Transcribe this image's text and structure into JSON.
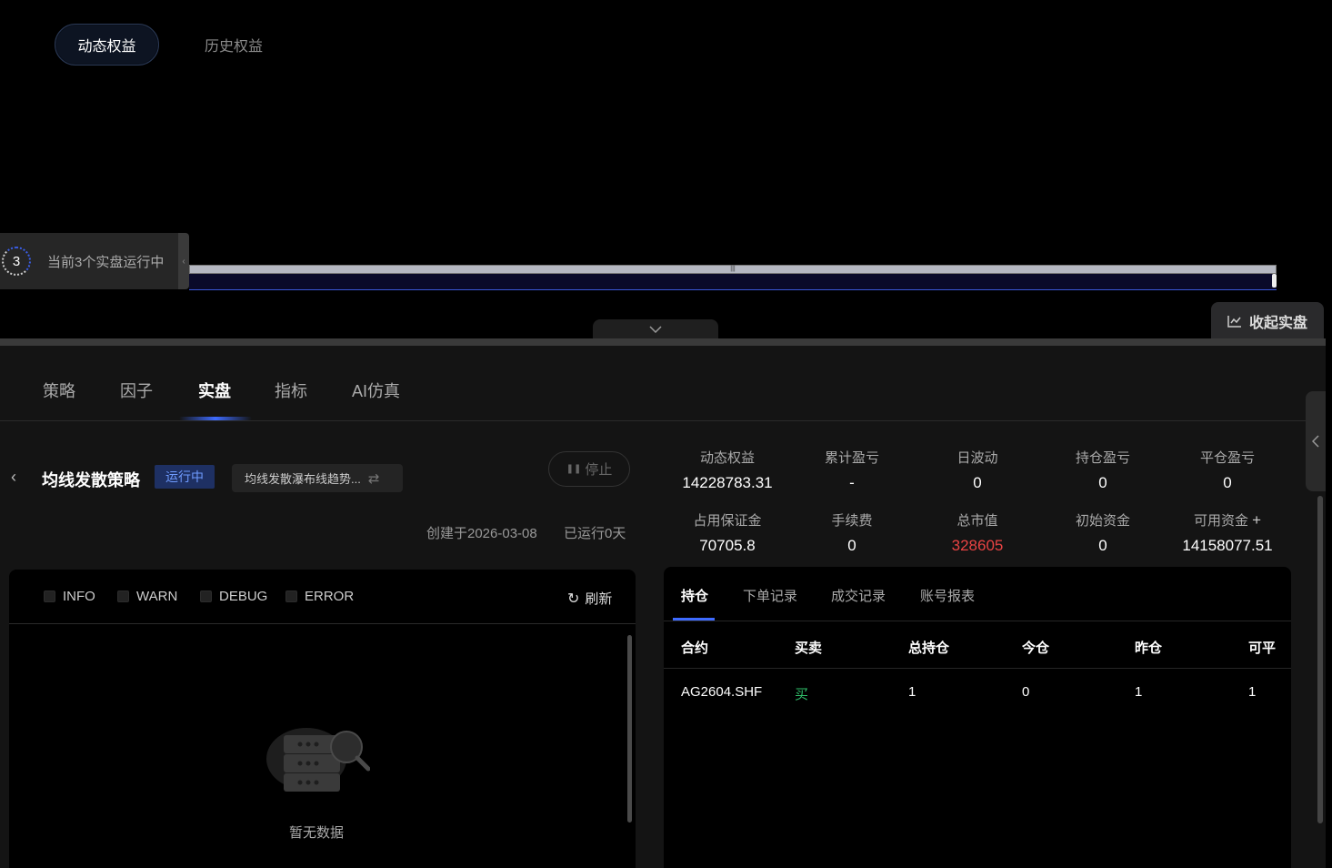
{
  "equity_tabs": {
    "dynamic": "动态权益",
    "history": "历史权益"
  },
  "running": {
    "count": "3",
    "text": "当前3个实盘运行中"
  },
  "collapse_label": "收起实盘",
  "main_tabs": [
    "策略",
    "因子",
    "实盘",
    "指标",
    "AI仿真"
  ],
  "strategy": {
    "name": "均线发散策略",
    "status": "运行中",
    "select_value": "均线发散瀑布线趋势...",
    "stop_label": "停止",
    "created": "创建于2026-03-08",
    "running_days": "已运行0天"
  },
  "metrics": [
    {
      "label": "动态权益",
      "value": "14228783.31"
    },
    {
      "label": "累计盈亏",
      "value": "-"
    },
    {
      "label": "日波动",
      "value": "0"
    },
    {
      "label": "持仓盈亏",
      "value": "0"
    },
    {
      "label": "平仓盈亏",
      "value": "0"
    },
    {
      "label": "占用保证金",
      "value": "70705.8"
    },
    {
      "label": "手续费",
      "value": "0"
    },
    {
      "label": "总市值",
      "value": "328605"
    },
    {
      "label": "初始资金",
      "value": "0"
    },
    {
      "label": "可用资金",
      "value": "14158077.51"
    }
  ],
  "log": {
    "filters": [
      "INFO",
      "WARN",
      "DEBUG",
      "ERROR"
    ],
    "refresh": "刷新",
    "empty": "暂无数据"
  },
  "positions": {
    "tabs": [
      "持仓",
      "下单记录",
      "成交记录",
      "账号报表"
    ],
    "columns": [
      "合约",
      "买卖",
      "总持仓",
      "今仓",
      "昨仓",
      "可平"
    ],
    "rows": [
      [
        "AG2604.SHF",
        "买",
        "1",
        "0",
        "1",
        "1"
      ]
    ]
  },
  "colors": {
    "accent": "#3e6bff",
    "loss": "#e84343",
    "buy": "#2fbf6a"
  }
}
